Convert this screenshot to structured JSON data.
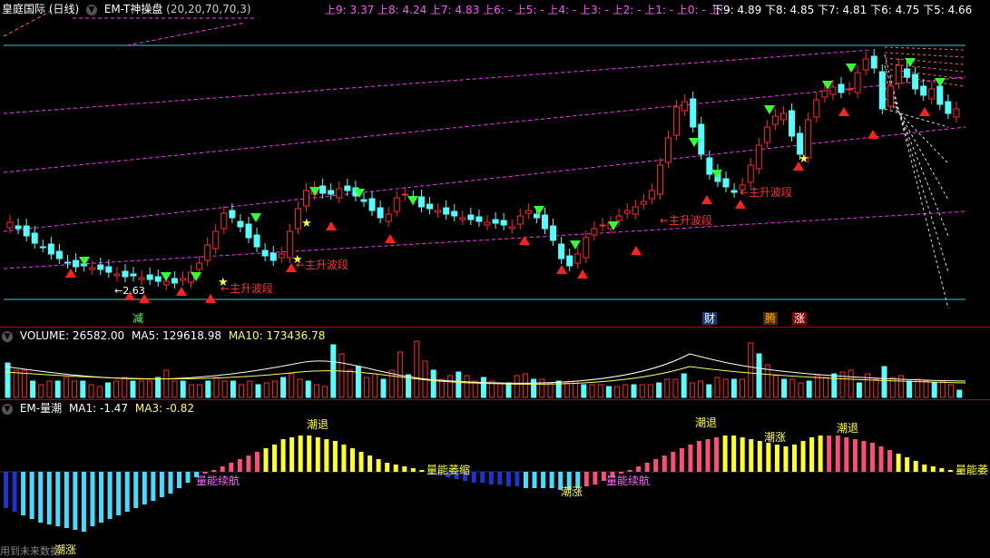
{
  "header": {
    "stock": "皇庭国际 (日线)",
    "indicator_name": "EM-T神操盘",
    "indicator_params": "(20,20,70,70,3)",
    "levels_up": "上9: 3.37  上8: 4.24  上7: 4.83  上6: -  上5: -  上4: -  上3: -  上2: -  上1: -  上0: -  上: -",
    "levels_down": "下9: 4.89  下8: 4.85  下7: 4.81  下6: 4.75  下5: 4.66"
  },
  "main_labels": {
    "wave_label": "←主升波段",
    "low_price": "←2.63",
    "event_tags": [
      "减",
      "财",
      "腾",
      "涨"
    ]
  },
  "volume_header": {
    "title": "VOLUME: 26582.00",
    "ma5": "MA5: 129618.98",
    "ma10": "MA10: 173436.78"
  },
  "indicator_header": {
    "title": "EM-量潮",
    "ma1": "MA1: -1.47",
    "ma3": "MA3: -0.82"
  },
  "indicator_labels": {
    "tide_up": "潮涨",
    "tide_down": "潮退",
    "energy_continue": "量能续航",
    "energy_shrink": "量能萎缩",
    "energy_shrink_partial": "量能萎"
  },
  "footer": {
    "future_data": "用到未来数据"
  },
  "colors": {
    "up": "#ff2a2a",
    "down": "#54ffff",
    "ma_white": "#ffffff",
    "ma_yellow": "#ffff55",
    "magenta": "#ff33ff",
    "pink_bar": "#ff4d7a",
    "yellow_bar": "#ffff22",
    "cyan_bar": "#44ddff",
    "blue_bar": "#2233cc"
  }
}
